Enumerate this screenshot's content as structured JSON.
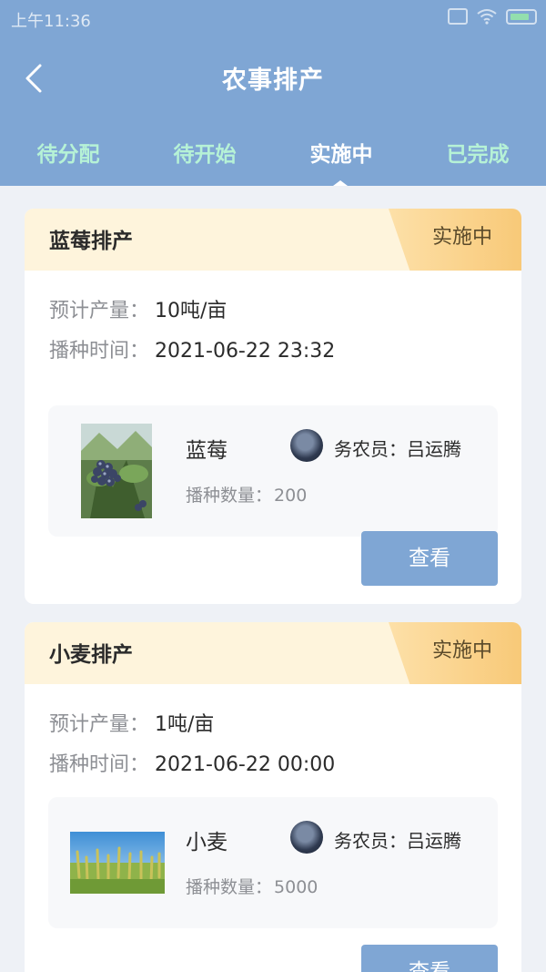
{
  "status_bar": {
    "time": "上午11:36"
  },
  "nav": {
    "title": "农事排产"
  },
  "tabs": [
    {
      "label": "待分配"
    },
    {
      "label": "待开始"
    },
    {
      "label": "实施中"
    },
    {
      "label": "已完成"
    }
  ],
  "active_tab": "实施中",
  "cards": [
    {
      "title": "蓝莓排产",
      "status": "实施中",
      "yield_label": "预计产量：",
      "yield_value": "10吨/亩",
      "sow_time_label": "播种时间：",
      "sow_time_value": "2021-06-22 23:32",
      "crop_name": "蓝莓",
      "farmer": "务农员：吕运腾",
      "sow_count_label": "播种数量：",
      "sow_count_value": "200",
      "button": "查看"
    },
    {
      "title": "小麦排产",
      "status": "实施中",
      "yield_label": "预计产量：",
      "yield_value": "1吨/亩",
      "sow_time_label": "播种时间：",
      "sow_time_value": "2021-06-22 00:00",
      "crop_name": "小麦",
      "farmer": "务农员：吕运腾",
      "sow_count_label": "播种数量：",
      "sow_count_value": "5000",
      "button": "查看"
    }
  ],
  "colors": {
    "header_bg": "#7fa6d4",
    "inactive_tab": "#b6f2d6",
    "badge_bg": "#f8c978",
    "button_bg": "#7fa6d4"
  },
  "icons": {
    "back": "chevron-left-icon",
    "wifi": "wifi-icon",
    "battery": "battery-icon",
    "sim": "sim-icon"
  }
}
